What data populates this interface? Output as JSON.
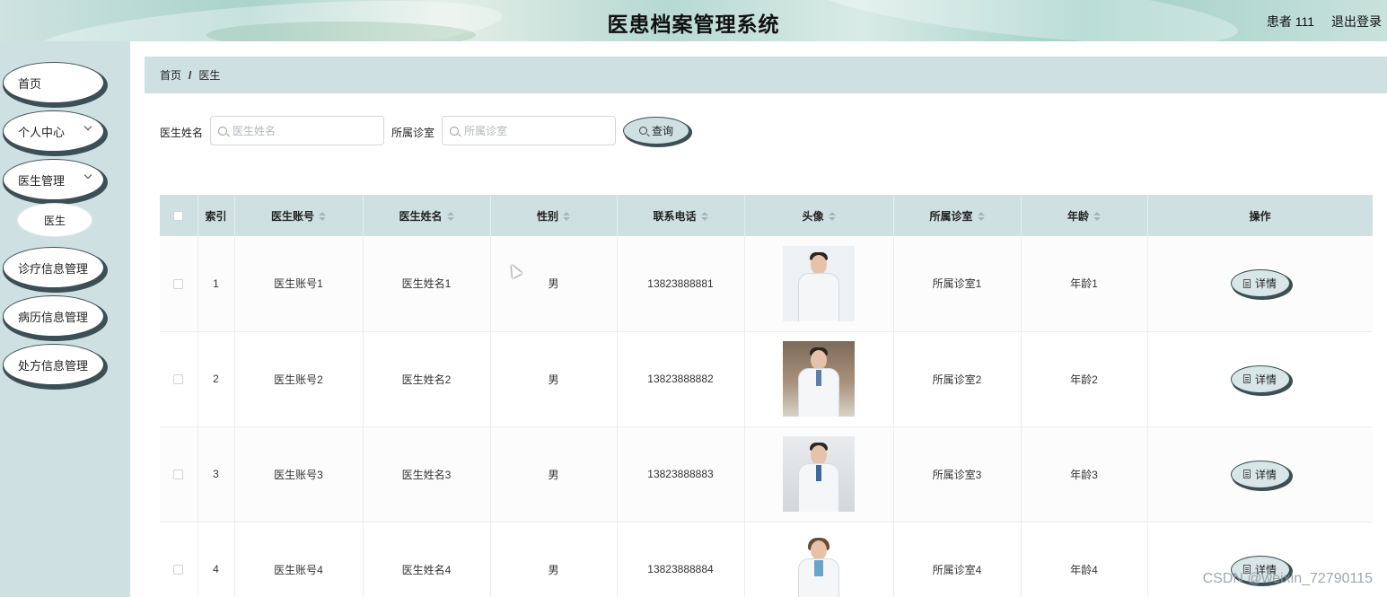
{
  "header": {
    "title": "医患档案管理系统",
    "user": "患者 111",
    "logout": "退出登录"
  },
  "sidebar": {
    "items": [
      {
        "label": "首页"
      },
      {
        "label": "个人中心"
      },
      {
        "label": "医生管理"
      },
      {
        "label": "诊疗信息管理"
      },
      {
        "label": "病历信息管理"
      },
      {
        "label": "处方信息管理"
      }
    ],
    "submenu": {
      "label": "医生"
    }
  },
  "breadcrumb": {
    "home": "首页",
    "sep": "/",
    "current": "医生"
  },
  "search": {
    "name_label": "医生姓名",
    "name_placeholder": "医生姓名",
    "clinic_label": "所属诊室",
    "clinic_placeholder": "所属诊室",
    "query_label": "查询"
  },
  "table": {
    "headers": {
      "index": "索引",
      "account": "医生账号",
      "name": "医生姓名",
      "gender": "性别",
      "phone": "联系电话",
      "avatar": "头像",
      "clinic": "所属诊室",
      "age": "年龄",
      "action": "操作"
    },
    "detail_label": "详情",
    "rows": [
      {
        "index": "1",
        "account": "医生账号1",
        "name": "医生姓名1",
        "gender": "男",
        "phone": "13823888881",
        "clinic": "所属诊室1",
        "age": "年龄1"
      },
      {
        "index": "2",
        "account": "医生账号2",
        "name": "医生姓名2",
        "gender": "男",
        "phone": "13823888882",
        "clinic": "所属诊室2",
        "age": "年龄2"
      },
      {
        "index": "3",
        "account": "医生账号3",
        "name": "医生姓名3",
        "gender": "男",
        "phone": "13823888883",
        "clinic": "所属诊室3",
        "age": "年龄3"
      },
      {
        "index": "4",
        "account": "医生账号4",
        "name": "医生姓名4",
        "gender": "男",
        "phone": "13823888884",
        "clinic": "所属诊室4",
        "age": "年龄4"
      }
    ]
  },
  "watermark": "CSDN @weixin_72790115",
  "colors": {
    "accent": "#cfe0e3",
    "border_dark": "#3b4f55"
  }
}
